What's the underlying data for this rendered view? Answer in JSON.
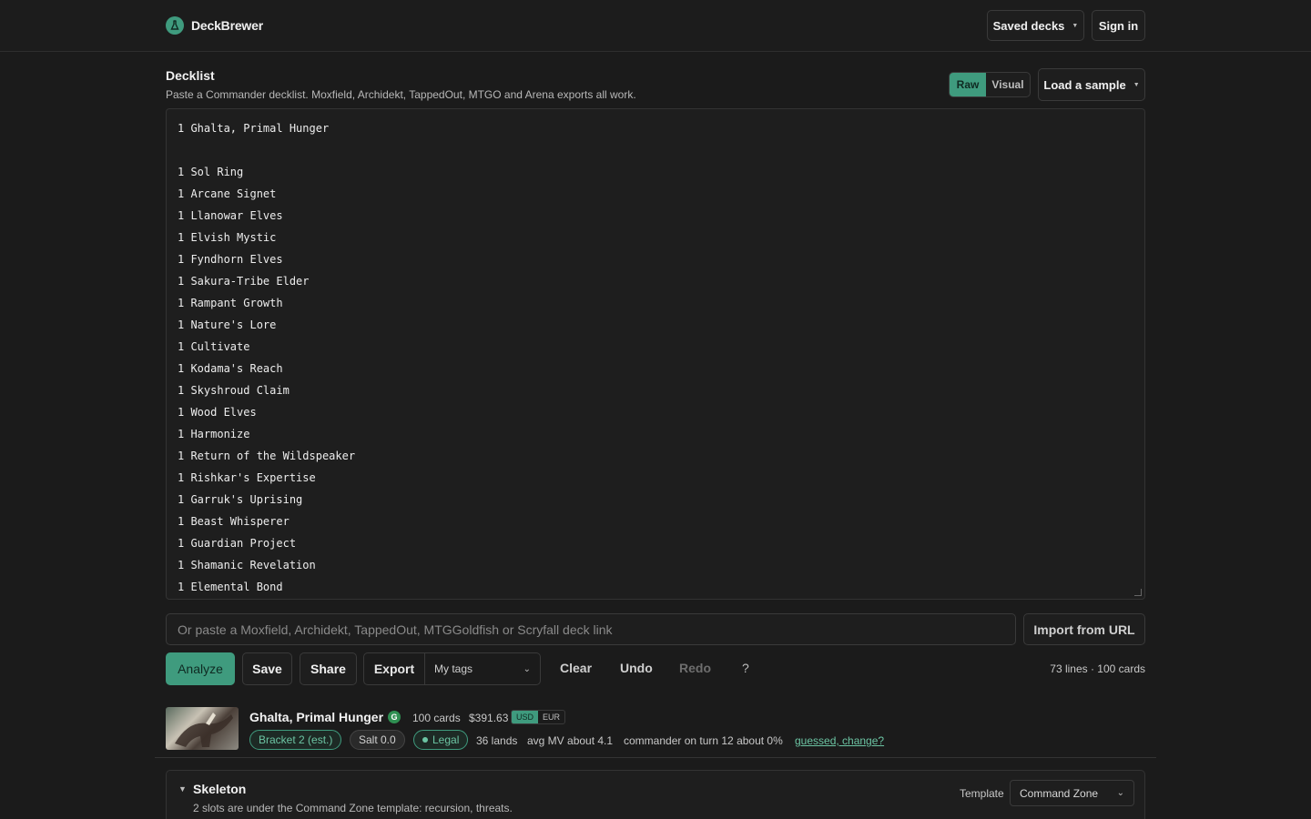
{
  "brand": {
    "name": "DeckBrewer",
    "icon": "flask-icon",
    "accent": "#3f9b7e"
  },
  "header": {
    "saved_decks": "Saved decks",
    "sign_in": "Sign in"
  },
  "decklist": {
    "title": "Decklist",
    "subtitle": "Paste a Commander decklist. Moxfield, Archidekt, TappedOut, MTGO and Arena exports all work.",
    "view_modes": [
      "Raw",
      "Visual"
    ],
    "active_view": "Raw",
    "load_sample": "Load a sample",
    "lines": [
      "1 Ghalta, Primal Hunger",
      "",
      "1 Sol Ring",
      "1 Arcane Signet",
      "1 Llanowar Elves",
      "1 Elvish Mystic",
      "1 Fyndhorn Elves",
      "1 Sakura-Tribe Elder",
      "1 Rampant Growth",
      "1 Nature's Lore",
      "1 Cultivate",
      "1 Kodama's Reach",
      "1 Skyshroud Claim",
      "1 Wood Elves",
      "1 Harmonize",
      "1 Return of the Wildspeaker",
      "1 Rishkar's Expertise",
      "1 Garruk's Uprising",
      "1 Beast Whisperer",
      "1 Guardian Project",
      "1 Shamanic Revelation",
      "1 Elemental Bond"
    ]
  },
  "import": {
    "placeholder": "Or paste a Moxfield, Archidekt, TappedOut, MTGGoldfish or Scryfall deck link",
    "button": "Import from URL"
  },
  "actions": {
    "analyze": "Analyze",
    "save": "Save",
    "share": "Share",
    "export": "Export",
    "tags_select": "My tags",
    "clear": "Clear",
    "undo": "Undo",
    "redo": "Redo",
    "help": "?",
    "counts": "73 lines · 100 cards"
  },
  "summary": {
    "commander": "Ghalta, Primal Hunger",
    "color_identity": "G",
    "cards": "100 cards",
    "price": "$391.63",
    "currencies": [
      "USD",
      "EUR"
    ],
    "active_currency": "USD",
    "bracket": "Bracket 2 (est.)",
    "salt": "Salt 0.0",
    "legality": "Legal",
    "lands": "36 lands",
    "avg_mv": "avg MV about 4.1",
    "commander_turn": "commander on turn 12 about 0%",
    "guess_link": "guessed, change?"
  },
  "skeleton": {
    "title": "Skeleton",
    "subtitle": "2 slots are under the Command Zone template: recursion, threats.",
    "template_label": "Template",
    "template_value": "Command Zone"
  }
}
